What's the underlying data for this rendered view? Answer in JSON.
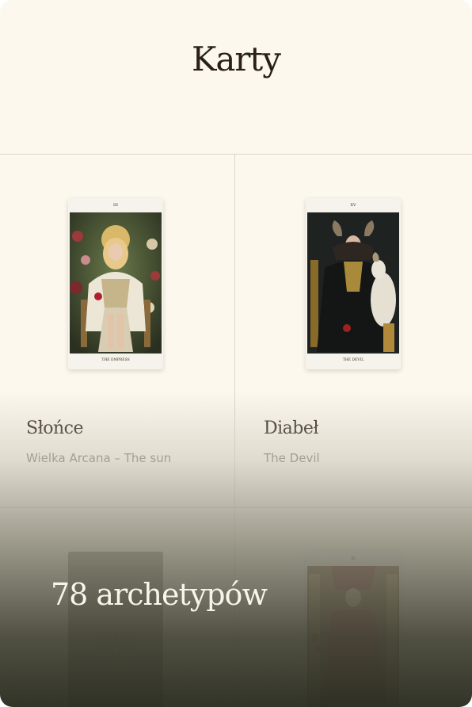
{
  "header": {
    "title": "Karty"
  },
  "grid": {
    "cards": [
      {
        "numeral": "III",
        "card_label": "THE EMPRESS",
        "title": "Słońce",
        "subtitle": "Wielka Arcana – The sun"
      },
      {
        "numeral": "XV",
        "card_label": "THE DEVIL",
        "title": "Diabeł",
        "subtitle": "The Devil"
      },
      {
        "numeral": "",
        "card_label": "",
        "title": "",
        "subtitle": ""
      },
      {
        "numeral": "XI",
        "card_label": "",
        "title": "",
        "subtitle": ""
      }
    ]
  },
  "promo": {
    "text": "78 archetypów"
  },
  "colors": {
    "background": "#fcf8ee",
    "text_dark": "#2b2016",
    "text_muted": "#7d7468",
    "overlay_dark": "#2e3024"
  }
}
